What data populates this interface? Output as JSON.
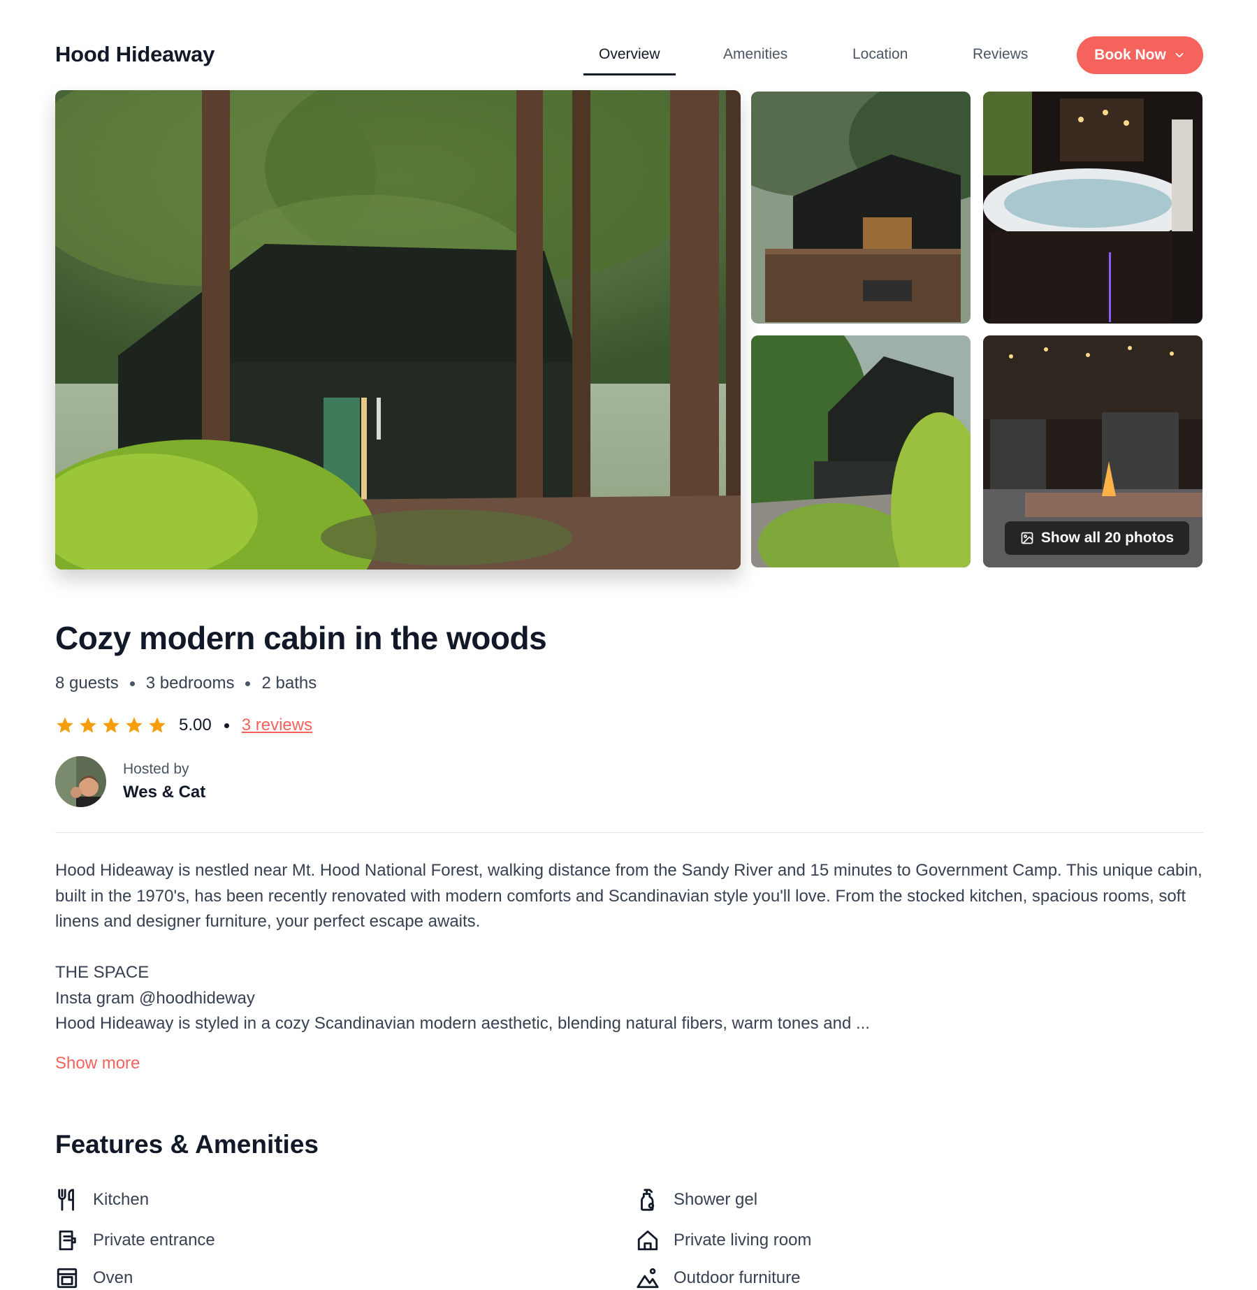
{
  "brand": "Hood Hideaway",
  "nav": {
    "links": [
      "Overview",
      "Amenities",
      "Location",
      "Reviews"
    ],
    "active": "Overview",
    "book_label": "Book Now"
  },
  "gallery": {
    "show_all_label": "Show all 20 photos"
  },
  "listing": {
    "title": "Cozy modern cabin in the woods",
    "guests": "8 guests",
    "bedrooms": "3 bedrooms",
    "baths": "2 baths",
    "rating": "5.00",
    "stars": 5,
    "reviews_label": "3 reviews",
    "hosted_by_label": "Hosted by",
    "host_name": "Wes & Cat"
  },
  "description": {
    "paragraph": "Hood Hideaway is nestled near Mt. Hood National Forest, walking distance from the Sandy River and 15 minutes to Government Camp. This unique cabin, built in the 1970's, has been recently renovated with modern comforts and Scandinavian style you'll love. From the stocked kitchen, spacious rooms, soft linens and designer furniture, your perfect escape awaits.",
    "space_heading": "THE SPACE",
    "insta_line": "Insta gram @hoodhideway",
    "space_text": "Hood Hideaway is styled in a cozy Scandinavian modern aesthetic, blending natural fibers, warm tones and ...",
    "show_more": "Show more"
  },
  "features": {
    "title": "Features & Amenities",
    "items": [
      {
        "label": "Kitchen",
        "icon": "utensils-icon"
      },
      {
        "label": "Shower gel",
        "icon": "soap-bottle-icon"
      },
      {
        "label": "Private entrance",
        "icon": "door-icon"
      },
      {
        "label": "Private living room",
        "icon": "home-icon"
      },
      {
        "label": "Oven",
        "icon": "oven-icon"
      },
      {
        "label": "Outdoor furniture",
        "icon": "mountain-sun-icon"
      }
    ]
  },
  "colors": {
    "accent": "#f6635c",
    "text": "#111827",
    "muted": "#374151",
    "star": "#f59e0b"
  }
}
